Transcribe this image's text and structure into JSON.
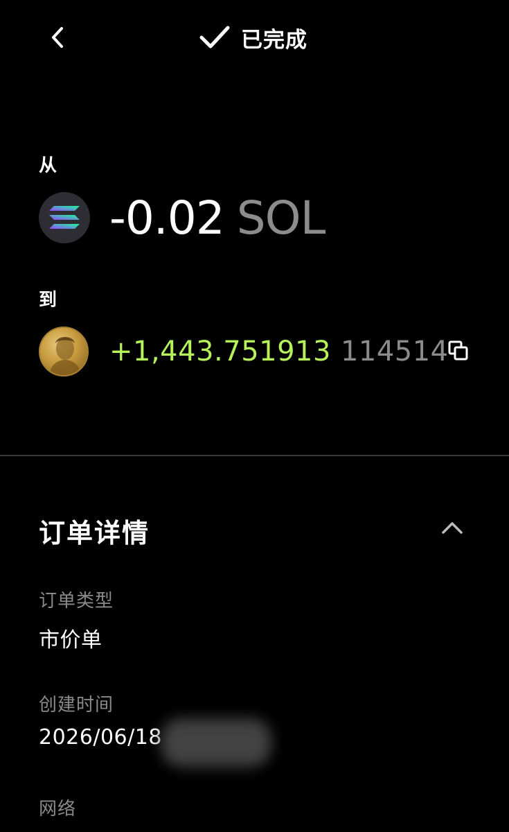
{
  "header": {
    "status_text": "已完成"
  },
  "from": {
    "label": "从",
    "amount": "-0.02",
    "unit": "SOL",
    "token_icon": "solana-logo-icon"
  },
  "to": {
    "label": "到",
    "amount": "+1,443.751913",
    "unit": "114514",
    "token_icon": "coin-portrait-icon"
  },
  "order": {
    "section_title": "订单详情",
    "type_label": "订单类型",
    "type_value": "市价单",
    "created_label": "创建时间",
    "created_value": "2026/06/18",
    "network_label": "网络"
  },
  "colors": {
    "background": "#000000",
    "positive_amount": "#b6f25a",
    "muted_text": "#8a8a8a",
    "unit_text": "#8c8c8c",
    "divider": "#3a3a3a"
  }
}
